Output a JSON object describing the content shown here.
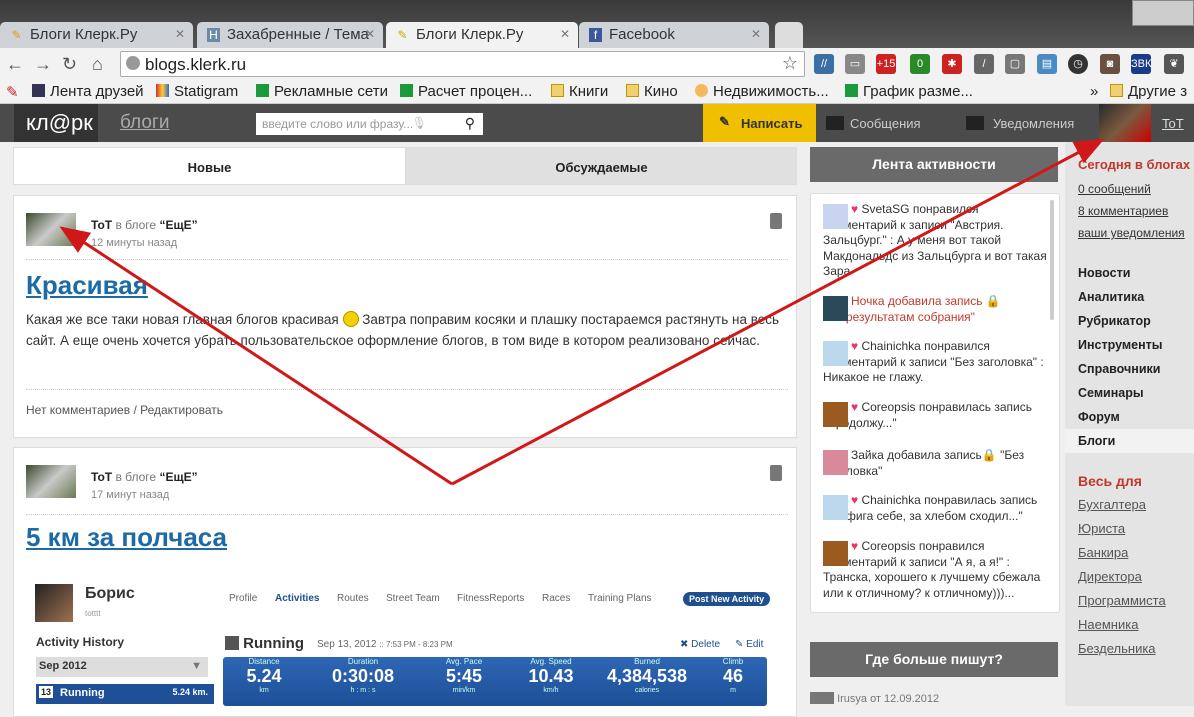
{
  "browser": {
    "tabs": [
      {
        "label": "Блоги Клерк.Ру",
        "icon": "pen-icon"
      },
      {
        "label": "Захабренные / Тема",
        "icon": "habr-icon"
      },
      {
        "label": "Блоги Клерк.Ру",
        "icon": "pen-icon",
        "active": true
      },
      {
        "label": "Facebook",
        "icon": "facebook-icon"
      }
    ],
    "url": "blogs.klerk.ru",
    "extension_badges": {
      "plus": "+15",
      "mail": "0",
      "vk": "ЗВК"
    },
    "bookmarks": [
      "Лента друзей",
      "Statigram",
      "Рекламные сети",
      "Расчет процен...",
      "Книги",
      "Кино",
      "Недвижимость...",
      "График разме..."
    ],
    "bookmarks_overflow": "»",
    "other_bookmarks": "Другие з"
  },
  "header": {
    "logo": "кл@рк",
    "section": "блоги",
    "search_placeholder": "введите слово или фразу...",
    "write": "Написать",
    "messages": "Сообщения",
    "notifications": "Уведомления",
    "user": "ToT",
    "accent": "#f0c000"
  },
  "main_tabs": [
    "Новые",
    "Обсуждаемые"
  ],
  "posts": [
    {
      "author": "ToT",
      "in_blog": "в блоге",
      "blog": "“ЕщЕ”",
      "ago": "12 минуты назад",
      "title": "Красивая",
      "text1": "Какая же все таки новая главная блогов красивая ",
      "text2": " Завтра поправим косяки и плашку постараемся растянуть на весь сайт.  А еще очень хочется убрать пользовательское оформление блогов, в том виде в котором реализовано сейчас.",
      "comments": "Нет комментариев",
      "edit": "/ Редактировать"
    },
    {
      "author": "ToT",
      "in_blog": "в блоге",
      "blog": "“ЕщЕ”",
      "ago": "17 минут назад",
      "title": "5 км за полчаса"
    }
  ],
  "embedded": {
    "name": "Борис",
    "handle": "totttt",
    "tabs": [
      "Profile",
      "Activities",
      "Routes",
      "Street Team",
      "FitnessReports",
      "Races",
      "Training Plans"
    ],
    "post_btn": "Post New Activity",
    "history": "Activity History",
    "month": "Sep 2012",
    "item": "Running",
    "item_dist": "5.24 km.",
    "day": "13",
    "activity": "Running",
    "date": "Sep 13, 2012",
    "time": ":: 7:53 PM - 8:23 PM",
    "delete": "✖ Delete",
    "edit": "✎ Edit",
    "stats": [
      {
        "l": "Distance",
        "v": "5.24",
        "u": "km"
      },
      {
        "l": "Duration",
        "v": "0:30:08",
        "u": "h : m : s"
      },
      {
        "l": "Avg. Pace",
        "v": "5:45",
        "u": "min/km"
      },
      {
        "l": "Avg. Speed",
        "v": "10.43",
        "u": "km/h"
      },
      {
        "l": "Burned",
        "v": "4,384,538",
        "u": "calories"
      },
      {
        "l": "Climb",
        "v": "46",
        "u": "m"
      }
    ]
  },
  "sidebar": {
    "activity_title": "Лента активности",
    "feed": [
      {
        "text": "SvetaSG понравился комментарий к записи \"Австрия. Зальцбург.\" : А у меня вот такой Макдональдс из Зальцбурга и вот такая Зара"
      },
      {
        "text": "Ночка добавила запись",
        "extra": "\"По результатам собрания\"",
        "red": true
      },
      {
        "text": "Chainichka понравился комментарий к записи \"Без заголовка\" : Никакое не глажу."
      },
      {
        "text": "Coreopsis понравилась запись \"Продолжу...\""
      },
      {
        "text": "Зайка добавила запись",
        "extra": " \"Без заголовка\""
      },
      {
        "text": "Chainichka понравилась запись \"Ни фига себе, за хлебом сходил...\""
      },
      {
        "text": "Coreopsis понравился комментарий к записи \"А я, а я!\" : Транска, хорошего к лучшему сбежала или к отличному? к отличному)))..."
      }
    ],
    "where_title": "Где больше пишут?",
    "where_first": "Irusya от 12.09.2012"
  },
  "right": {
    "today": "Сегодня в блогах",
    "links": [
      "0 сообщений",
      "8 комментариев",
      "ваши уведомления"
    ],
    "nav": [
      "Новости",
      "Аналитика",
      "Рубрикатор",
      "Инструменты",
      "Справочники",
      "Семинары",
      "Форум",
      "Блоги"
    ],
    "for_title": "Весь для",
    "for": [
      "Бухгалтера",
      "Юриста",
      "Банкира",
      "Директора",
      "Программиста",
      "Наемника",
      "Бездельника"
    ]
  }
}
